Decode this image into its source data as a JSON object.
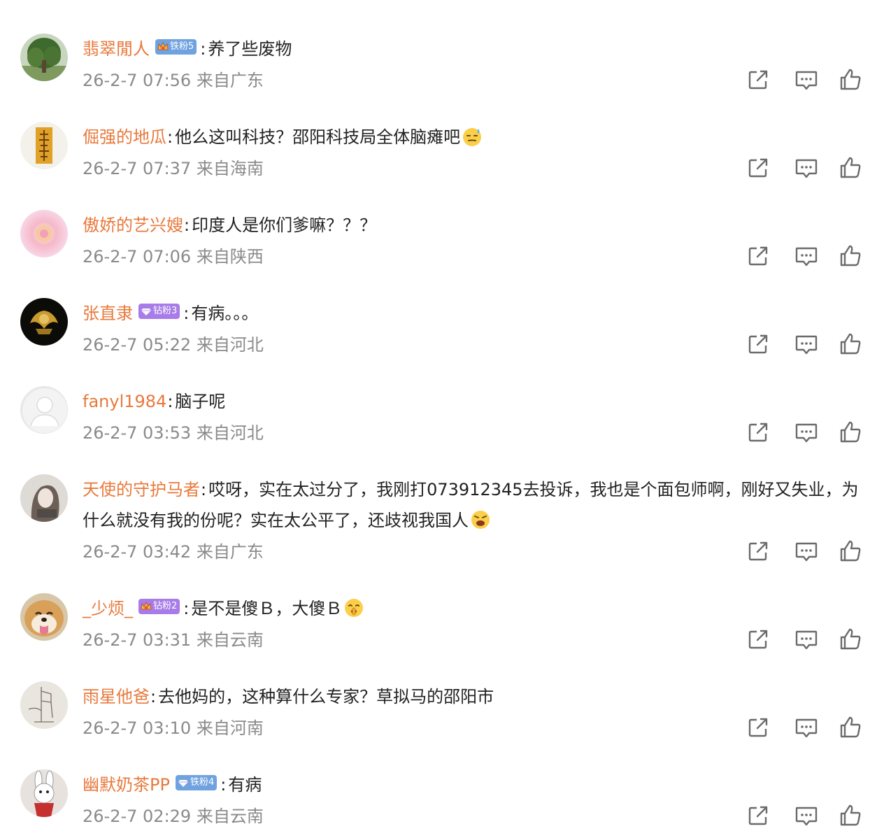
{
  "comments": [
    {
      "user": "翡翠閒人",
      "badge": {
        "type": "iron",
        "label": "铁粉5",
        "icon": "crown-icon"
      },
      "text": "养了些废物",
      "meta": "26-2-7 07:56 来自广东",
      "avatar": "tree-avatar"
    },
    {
      "user": "倔强的地瓜",
      "badge": null,
      "text": "他么这叫科技？邵阳科技局全体脑瘫吧",
      "emoji": "sweat-emoji",
      "meta": "26-2-7 07:37 来自海南",
      "avatar": "calligraphy-avatar"
    },
    {
      "user": "傲娇的艺兴嫂",
      "badge": null,
      "text": "印度人是你们爹嘛？？？",
      "meta": "26-2-7 07:06 来自陕西",
      "avatar": "pink-flower-avatar"
    },
    {
      "user": "张直隶",
      "badge": {
        "type": "diamond",
        "label": "钻粉3",
        "icon": "diamond-icon"
      },
      "text": "有病。。。",
      "meta": "26-2-7 05:22 来自河北",
      "avatar": "gold-emblem-avatar"
    },
    {
      "user": "fanyl1984",
      "badge": null,
      "text": "脑子呢",
      "meta": "26-2-7 03:53 来自河北",
      "avatar": "default-avatar"
    },
    {
      "user": "天使的守护马者",
      "badge": null,
      "text": "哎呀，实在太过分了，我刚打073912345去投诉，我也是个面包师啊，刚好又失业，为什么就没有我的份呢？实在太公平了，还歧视我国人",
      "emoji": "angry-emoji",
      "meta": "26-2-7 03:42 来自广东",
      "avatar": "girl-avatar"
    },
    {
      "user": "_少烦_",
      "badge": {
        "type": "diamond",
        "label": "钻粉2",
        "icon": "crown-icon"
      },
      "text": "是不是傻Ｂ，大傻Ｂ",
      "emoji": "shush-emoji",
      "meta": "26-2-7 03:31 来自云南",
      "avatar": "shiba-avatar"
    },
    {
      "user": "雨星他爸",
      "badge": null,
      "text": "去他妈的，这种算什么专家？草拟马的邵阳市",
      "meta": "26-2-7 03:10 来自河南",
      "avatar": "sketch-avatar"
    },
    {
      "user": "幽默奶茶PP",
      "badge": {
        "type": "iron",
        "label": "铁粉4",
        "icon": "diamond-icon"
      },
      "text": "有病",
      "meta": "26-2-7 02:29 来自云南",
      "avatar": "rabbit-avatar"
    }
  ],
  "actions": {
    "share": "share-icon",
    "comment": "comment-icon",
    "like": "like-icon"
  },
  "colors": {
    "username": "#e8793c",
    "text": "#222222",
    "meta": "#8a8a8a",
    "icon": "#6b6b6b",
    "iron_badge": "#6fa2df",
    "diamond_badge": "#a77ce8"
  }
}
